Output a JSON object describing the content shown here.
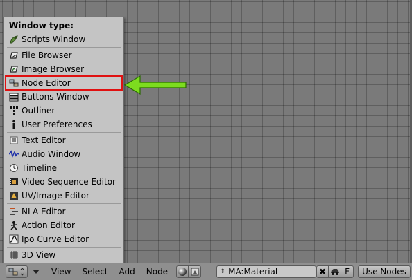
{
  "menu": {
    "title": "Window type:",
    "items": [
      {
        "label": "Scripts Window",
        "icon": "scripts-icon"
      },
      {
        "label": "File Browser",
        "icon": "file-browser-icon"
      },
      {
        "label": "Image Browser",
        "icon": "image-browser-icon"
      },
      {
        "label": "Node Editor",
        "icon": "node-editor-icon"
      },
      {
        "label": "Buttons Window",
        "icon": "buttons-window-icon"
      },
      {
        "label": "Outliner",
        "icon": "outliner-icon"
      },
      {
        "label": "User Preferences",
        "icon": "info-icon"
      },
      {
        "label": "Text Editor",
        "icon": "text-editor-icon"
      },
      {
        "label": "Audio Window",
        "icon": "audio-wave-icon"
      },
      {
        "label": "Timeline",
        "icon": "clock-icon"
      },
      {
        "label": "Video Sequence Editor",
        "icon": "film-icon"
      },
      {
        "label": "UV/Image Editor",
        "icon": "uv-image-icon"
      },
      {
        "label": "NLA Editor",
        "icon": "nla-icon"
      },
      {
        "label": "Action Editor",
        "icon": "action-icon"
      },
      {
        "label": "Ipo Curve Editor",
        "icon": "ipo-curve-icon"
      },
      {
        "label": "3D View",
        "icon": "grid-icon"
      }
    ],
    "highlighted": "Node Editor"
  },
  "header": {
    "menus": [
      "View",
      "Select",
      "Add",
      "Node"
    ],
    "material_field": "MA:Material",
    "x_label": "✖",
    "f_label": "F",
    "use_nodes_label": "Use Nodes"
  },
  "colors": {
    "highlight_outline": "#e01010",
    "arrow": "#7ddc1f"
  }
}
